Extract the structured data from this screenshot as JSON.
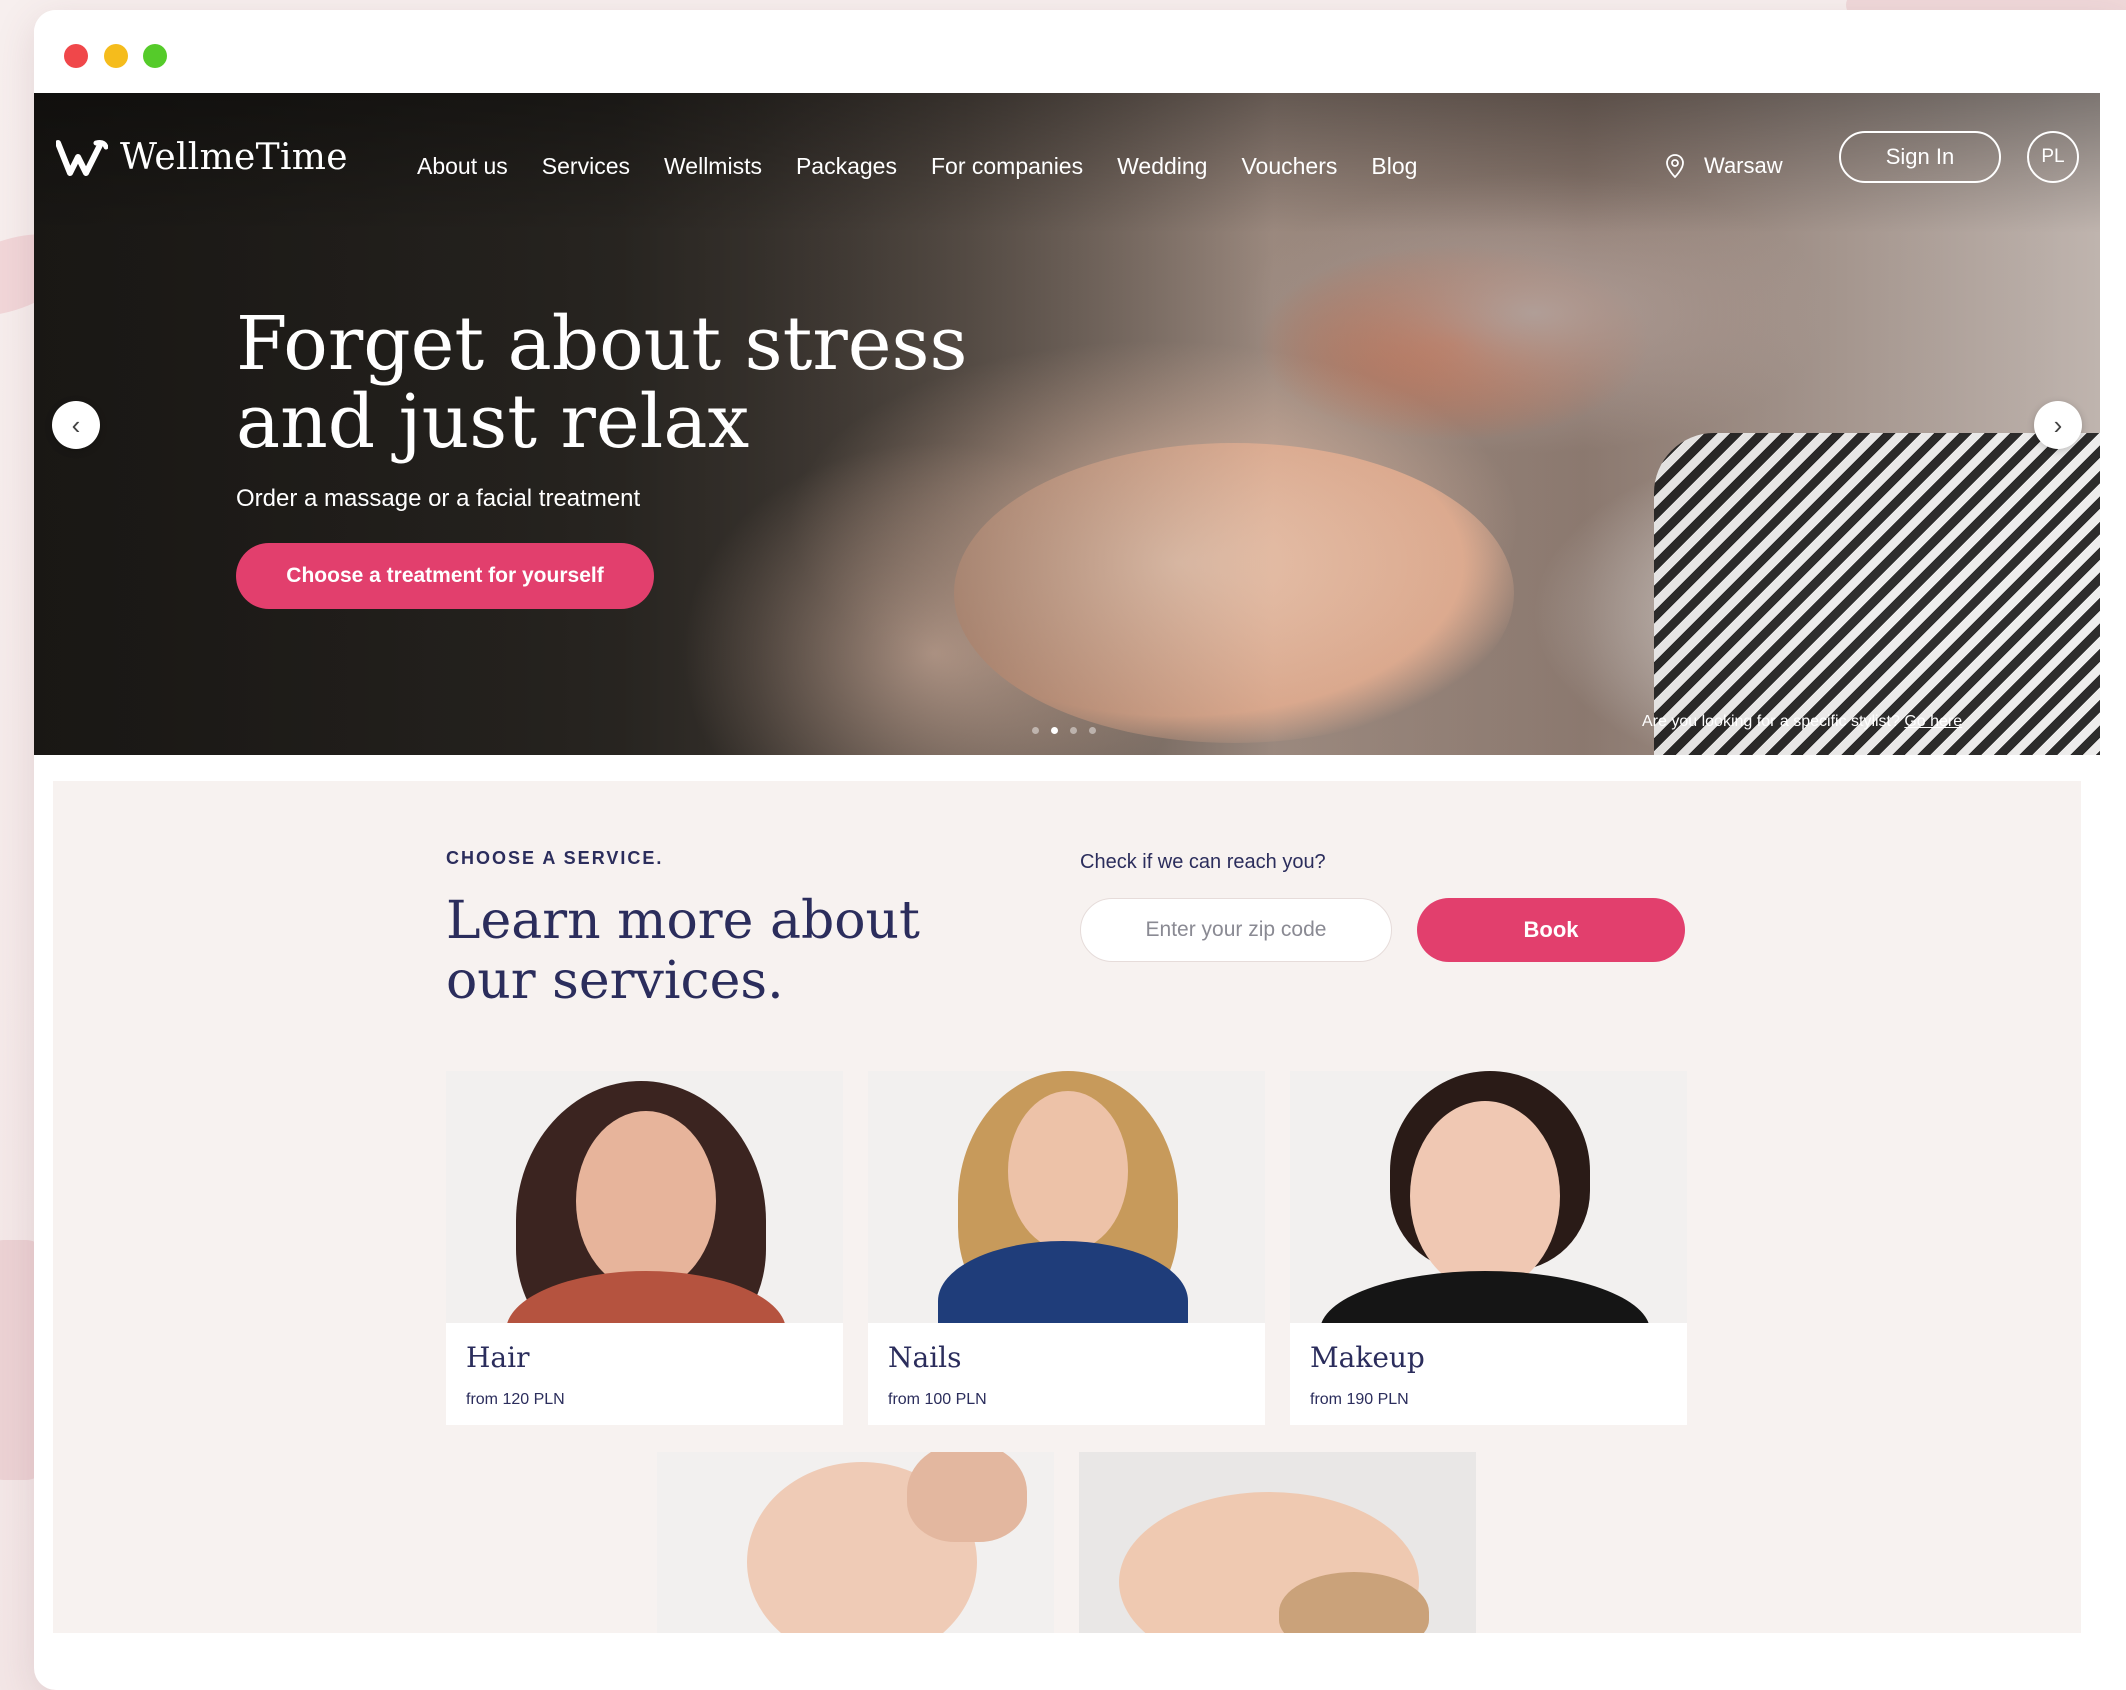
{
  "window": {
    "controls": [
      "close",
      "minimize",
      "maximize"
    ]
  },
  "brand": {
    "name": "WellmeTime",
    "logo_icon": "wellmetime-logo-icon"
  },
  "nav": {
    "items": [
      {
        "label": "About us"
      },
      {
        "label": "Services"
      },
      {
        "label": "Wellmists"
      },
      {
        "label": "Packages"
      },
      {
        "label": "For companies"
      },
      {
        "label": "Wedding"
      },
      {
        "label": "Vouchers"
      },
      {
        "label": "Blog"
      }
    ],
    "location": "Warsaw",
    "location_icon": "map-pin-icon",
    "sign_in": "Sign In",
    "language": "PL"
  },
  "hero": {
    "title": "Forget about stress and just relax",
    "subtitle": "Order a massage or a facial treatment",
    "cta": "Choose a treatment for yourself",
    "stylist_prompt": "Are you looking for a specific stylist?",
    "stylist_link": "Go here",
    "slides": 4,
    "active_slide": 2
  },
  "services": {
    "eyebrow": "CHOOSE A SERVICE.",
    "title": "Learn more about our services.",
    "zip_label": "Check if we can reach you?",
    "zip_placeholder": "Enter your zip code",
    "book": "Book",
    "cards": [
      {
        "name": "Hair",
        "price": "from 120 PLN"
      },
      {
        "name": "Nails",
        "price": "from 100 PLN"
      },
      {
        "name": "Makeup",
        "price": "from 190 PLN"
      },
      {
        "name": "",
        "price": ""
      },
      {
        "name": "",
        "price": ""
      }
    ]
  },
  "colors": {
    "accent": "#e23f6d",
    "navy": "#2b2d5c",
    "section_bg": "#f7f2f0"
  }
}
